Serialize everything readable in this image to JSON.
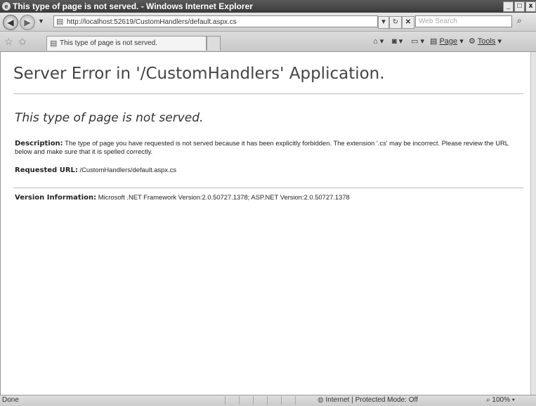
{
  "window": {
    "title": "This type of page is not served. - Windows Internet Explorer"
  },
  "toolbar": {
    "address": "http://localhost:52619/CustomHandlers/default.aspx.cs",
    "search_placeholder": "Web Search"
  },
  "tab": {
    "label": "This type of page is not served."
  },
  "command_bar": {
    "page_label": "Page",
    "tools_label": "Tools"
  },
  "page": {
    "heading": "Server Error in '/CustomHandlers' Application.",
    "error_title": "This type of page is not served.",
    "description_label": "Description:",
    "description_text": "The type of page you have requested is not served because it has been explicitly forbidden.  The extension '.cs' may be incorrect.   Please review the URL below and make sure that it is spelled correctly.",
    "requested_url_label": "Requested URL:",
    "requested_url": "/CustomHandlers/default.aspx.cs",
    "version_label": "Version Information:",
    "version_text": "Microsoft .NET Framework Version:2.0.50727.1378; ASP.NET Version:2.0.50727.1378"
  },
  "status_bar": {
    "status": "Done",
    "zone": "Internet | Protected Mode: Off",
    "zoom": "100%"
  }
}
